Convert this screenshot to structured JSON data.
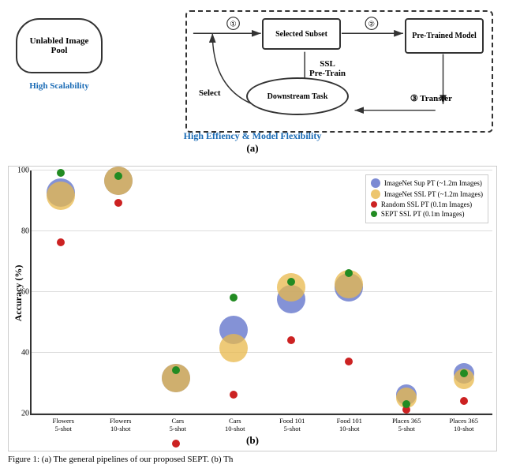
{
  "diagram": {
    "cloud_text": "Unlabled Image Pool",
    "high_scalability": "High Scalability",
    "selected_subset": "Selected Subset",
    "pretrained": "Pre-Trained Model",
    "downstream": "Downstream Task",
    "ssl_label": "SSL\nPre-Train",
    "select_label": "Select",
    "transfer_label": "③ Transfer",
    "num1": "①",
    "num2": "②",
    "bottom_blue": "High Effiency & Model Flexibility",
    "fig_a": "(a)"
  },
  "chart": {
    "y_label": "Accuracy (%)",
    "y_ticks": [
      "20",
      "40",
      "60",
      "80",
      "100"
    ],
    "x_labels": [
      {
        "line1": "Flowers",
        "line2": "5-shot"
      },
      {
        "line1": "Flowers",
        "line2": "10-shot"
      },
      {
        "line1": "Cars",
        "line2": "5-shot"
      },
      {
        "line1": "Cars",
        "line2": "10-shot"
      },
      {
        "line1": "Food 101",
        "line2": "5-shot"
      },
      {
        "line1": "Food 101",
        "line2": "10-shot"
      },
      {
        "line1": "Places 365",
        "line2": "5-shot"
      },
      {
        "line1": "Places 365",
        "line2": "10-shot"
      }
    ],
    "fig_b": "(b)",
    "legend": [
      {
        "label": "ImageNet Sup PT (~1.2m Images)",
        "color": "#5b6dc8",
        "size": "large"
      },
      {
        "label": "ImageNet SSL PT (~1.2m Images)",
        "color": "#e8b84b",
        "size": "large"
      },
      {
        "label": "Random SSL PT (0.1m Images)",
        "color": "#cc2222",
        "size": "small"
      },
      {
        "label": "SEPT SSL PT (0.1m Images)",
        "color": "#228b22",
        "size": "small"
      }
    ]
  },
  "caption": {
    "text": "Figure 1: (a) The general pipelines of our proposed SEPT. (b) Th"
  }
}
